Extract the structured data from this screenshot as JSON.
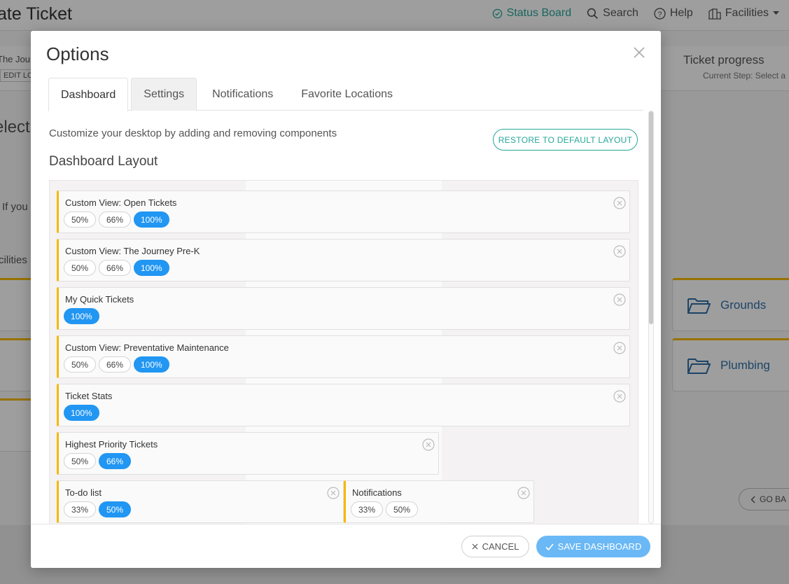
{
  "background": {
    "title": "ate Ticket",
    "nav": {
      "status_board": "Status Board",
      "search": "Search",
      "help": "Help",
      "facilities": "Facilities"
    },
    "journey": "The Journ",
    "edit_loc": "EDIT LOC",
    "ticket_progress": "Ticket progress",
    "current_step": "Current Step: Select a",
    "select": "elect",
    "if_you": "If you",
    "facilities_label": "cilities",
    "cards": [
      "Grounds",
      "Plumbing"
    ],
    "go_back": "GO BA"
  },
  "modal": {
    "title": "Options",
    "tabs": [
      {
        "label": "Dashboard",
        "active": true
      },
      {
        "label": "Settings",
        "active": false
      },
      {
        "label": "Notifications",
        "active": false
      },
      {
        "label": "Favorite Locations",
        "active": false
      }
    ],
    "description": "Customize your desktop by adding and removing components",
    "restore_label": "RESTORE TO DEFAULT LAYOUT",
    "layout_heading": "Dashboard Layout",
    "components": [
      {
        "name": "Custom View: Open Tickets",
        "sizes": [
          "50%",
          "66%",
          "100%"
        ],
        "selected": "100%"
      },
      {
        "name": "Custom View: The Journey Pre-K",
        "sizes": [
          "50%",
          "66%",
          "100%"
        ],
        "selected": "100%"
      },
      {
        "name": "My Quick Tickets",
        "sizes": [
          "100%"
        ],
        "selected": "100%"
      },
      {
        "name": "Custom View: Preventative Maintenance",
        "sizes": [
          "50%",
          "66%",
          "100%"
        ],
        "selected": "100%"
      },
      {
        "name": "Ticket Stats",
        "sizes": [
          "100%"
        ],
        "selected": "100%"
      },
      {
        "name": "Highest Priority Tickets",
        "sizes": [
          "50%",
          "66%"
        ],
        "selected": "66%"
      },
      {
        "name": "To-do list",
        "sizes": [
          "33%",
          "50%"
        ],
        "selected": "50%"
      },
      {
        "name": "Notifications",
        "sizes": [
          "33%",
          "50%"
        ],
        "selected": "none"
      }
    ],
    "cancel_label": "CANCEL",
    "save_label": "SAVE DASHBOARD"
  },
  "colors": {
    "accent_blue": "#2196f3",
    "teal": "#26a69a",
    "component_border": "#f5b800",
    "save_button": "#6ab8f5"
  }
}
